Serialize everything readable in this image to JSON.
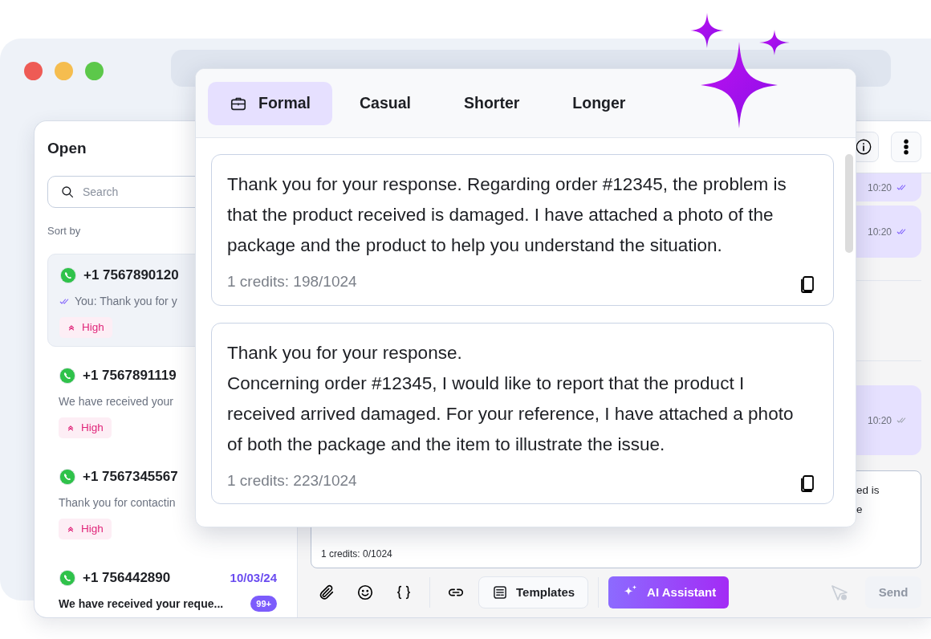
{
  "inbox": {
    "title": "Open",
    "search": {
      "placeholder": "Search"
    },
    "sort_label": "Sort by",
    "conversations": [
      {
        "phone": "+1 7567890120",
        "preview": "You: Thank you for y",
        "read_receipt": true,
        "selected": true,
        "unread": false,
        "priority": "High"
      },
      {
        "phone": "+1 7567891119",
        "preview": "We have received your",
        "read_receipt": false,
        "selected": false,
        "unread": false,
        "priority": "High"
      },
      {
        "phone": "+1 7567345567",
        "preview": "Thank you for contactin",
        "read_receipt": false,
        "selected": false,
        "unread": false,
        "priority": "High"
      },
      {
        "phone": "+1 756442890",
        "preview": "We have received your reque...",
        "read_receipt": false,
        "selected": false,
        "unread": true,
        "date": "10/03/24",
        "unread_count": "99+"
      }
    ]
  },
  "chat": {
    "messages": [
      {
        "time": "10:20",
        "read": true,
        "clipped": true
      },
      {
        "time": "10:20",
        "read": true,
        "clipped": false
      },
      {
        "time": "10:20",
        "read": false,
        "clipped": false
      }
    ],
    "composer": {
      "lines": [
        "ed is",
        "e"
      ],
      "credits": "1 credits: 0/1024"
    },
    "toolbar": {
      "templates": "Templates",
      "assistant": "AI Assistant",
      "send": {
        "label": "Send",
        "disabled": true
      }
    }
  },
  "rewrite_popup": {
    "tabs": [
      {
        "label": "Formal",
        "selected": true
      },
      {
        "label": "Casual",
        "selected": false
      },
      {
        "label": "Shorter",
        "selected": false
      },
      {
        "label": "Longer",
        "selected": false
      }
    ],
    "suggestions": [
      {
        "text": "Thank you for your response. Regarding order #12345, the problem is that the product received is damaged. I have attached a photo of the package and the product to help you understand the situation.",
        "credits": "1 credits: 198/1024"
      },
      {
        "text": "Thank you for your response.\nConcerning order #12345, I would like to report that the product I received arrived damaged. For your reference, I have attached a photo of both the package and the item to illustrate the issue.",
        "credits": "1 credits: 223/1024"
      }
    ]
  }
}
